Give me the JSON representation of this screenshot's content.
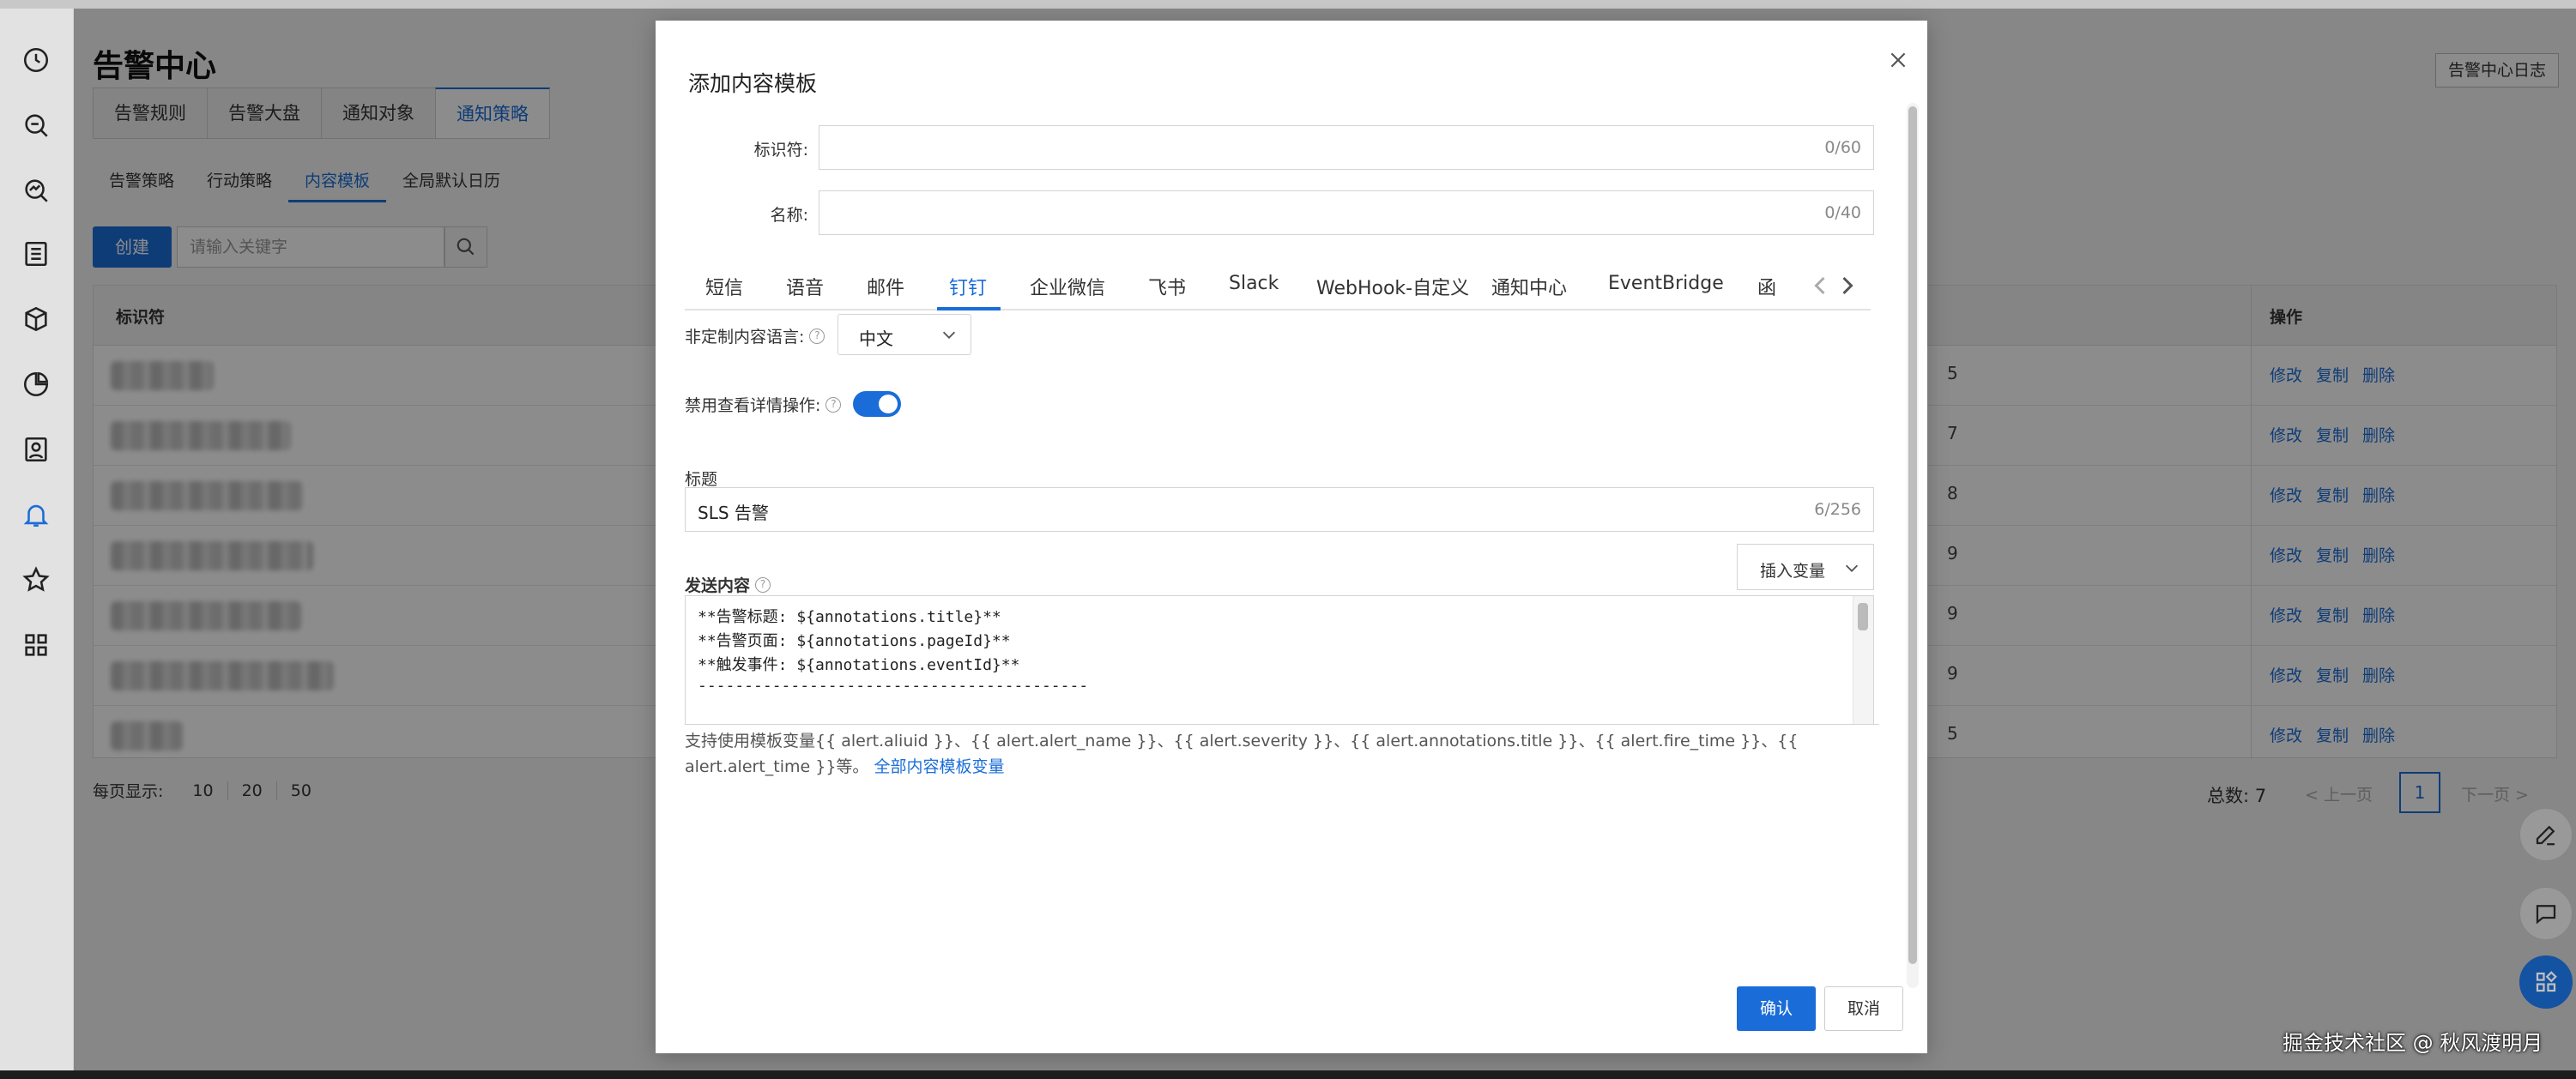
{
  "page": {
    "title": "告警中心",
    "tabs": [
      "告警规则",
      "告警大盘",
      "通知对象",
      "通知策略"
    ],
    "active_tab": "通知策略",
    "subtabs": [
      "告警策略",
      "行动策略",
      "内容模板",
      "全局默认日历"
    ],
    "active_subtab": "内容模板",
    "create_label": "创建",
    "search_placeholder": "请输入关键字",
    "log_button": "告警中心日志",
    "table": {
      "col_identifier": "标识符",
      "col_actions": "操作",
      "rows": [
        {
          "digit": "5",
          "actions": [
            "修改",
            "复制",
            "删除"
          ]
        },
        {
          "digit": "7",
          "actions": [
            "修改",
            "复制",
            "删除"
          ]
        },
        {
          "digit": "8",
          "actions": [
            "修改",
            "复制",
            "删除"
          ]
        },
        {
          "digit": "9",
          "actions": [
            "修改",
            "复制",
            "删除"
          ]
        },
        {
          "digit": "9",
          "actions": [
            "修改",
            "复制",
            "删除"
          ]
        },
        {
          "digit": "9",
          "actions": [
            "修改",
            "复制",
            "删除"
          ]
        },
        {
          "digit": "5",
          "actions": [
            "修改",
            "复制",
            "删除"
          ]
        }
      ]
    },
    "pagination": {
      "per_page_label": "每页显示:",
      "sizes": [
        "10",
        "20",
        "50"
      ],
      "total": "总数: 7",
      "prev": "< 上一页",
      "current": "1",
      "next": "下一页 >"
    }
  },
  "modal": {
    "title": "添加内容模板",
    "identifier_label": "标识符:",
    "identifier_count": "0/60",
    "name_label": "名称:",
    "name_count": "0/40",
    "channels": [
      "短信",
      "语音",
      "邮件",
      "钉钉",
      "企业微信",
      "飞书",
      "Slack",
      "WebHook-自定义",
      "通知中心",
      "EventBridge",
      "函"
    ],
    "active_channel": "钉钉",
    "language_label": "非定制内容语言:",
    "language_value": "中文",
    "disable_detail_label": "禁用查看详情操作:",
    "disable_detail_on": true,
    "title_label": "标题",
    "title_value": "SLS 告警",
    "title_count": "6/256",
    "content_label": "发送内容",
    "insert_variable": "插入变量",
    "content_lines": [
      "**告警标题: ${annotations.title}**",
      "**告警页面: ${annotations.pageId}**",
      "**触发事件: ${annotations.eventId}**",
      "------------------------------------------"
    ],
    "help_text": "支持使用模板变量{{ alert.aliuid }}、{{ alert.alert_name }}、{{ alert.severity }}、{{ alert.annotations.title }}、{{ alert.fire_time }}、{{ alert.alert_time }}等。",
    "help_link": "全部内容模板变量",
    "confirm": "确认",
    "cancel": "取消"
  },
  "watermark": "掘金技术社区 @ 秋风渡明月",
  "colors": {
    "accent": "#1a6dd8",
    "overlay": "#7f7f7f"
  }
}
